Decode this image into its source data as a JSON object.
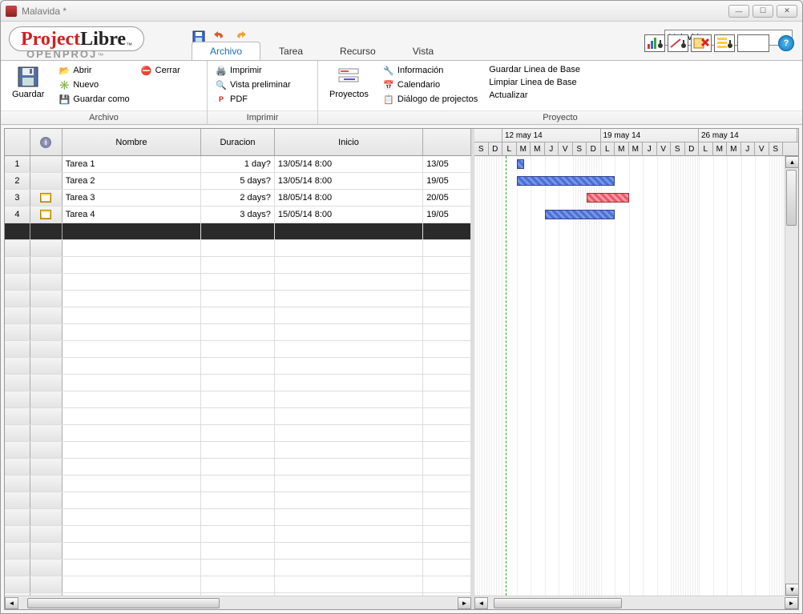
{
  "window_title": "Malavida *",
  "logo": {
    "part1": "Project",
    "part2": "Libre",
    "sub": "OPENPROJ"
  },
  "project_combo": "Malavida",
  "tabs": {
    "archivo": "Archivo",
    "tarea": "Tarea",
    "recurso": "Recurso",
    "vista": "Vista"
  },
  "ribbon": {
    "archivo": {
      "guardar": "Guardar",
      "abrir": "Abrir",
      "nuevo": "Nuevo",
      "guardar_como": "Guardar como",
      "cerrar": "Cerrar",
      "label": "Archivo"
    },
    "imprimir": {
      "imprimir": "Imprimir",
      "vista_prelim": "Vista preliminar",
      "pdf": "PDF",
      "label": "Imprimir"
    },
    "proyecto": {
      "proyectos": "Proyectos",
      "informacion": "Información",
      "calendario": "Calendario",
      "dialogo": "Diálogo de projectos",
      "guardar_linea": "Guardar Linea de Base",
      "limpiar_linea": "Limpiar Linea de Base",
      "actualizar": "Actualizar",
      "label": "Proyecto"
    }
  },
  "grid": {
    "headers": {
      "nombre": "Nombre",
      "duracion": "Duracion",
      "inicio": "Inicio"
    },
    "rows": [
      {
        "n": "1",
        "icon": "",
        "name": "Tarea 1",
        "dur": "1 day?",
        "start": "13/05/14 8:00",
        "end": "13/05"
      },
      {
        "n": "2",
        "icon": "",
        "name": "Tarea 2",
        "dur": "5 days?",
        "start": "13/05/14 8:00",
        "end": "19/05"
      },
      {
        "n": "3",
        "icon": "cal",
        "name": "Tarea 3",
        "dur": "2 days?",
        "start": "18/05/14 8:00",
        "end": "20/05"
      },
      {
        "n": "4",
        "icon": "cal",
        "name": "Tarea 4",
        "dur": "3 days?",
        "start": "15/05/14 8:00",
        "end": "19/05"
      }
    ]
  },
  "timeline": {
    "weeks": [
      "12 may 14",
      "19 may 14",
      "26 may 14"
    ],
    "days": [
      "S",
      "D",
      "L",
      "M",
      "M",
      "J",
      "V",
      "S",
      "D",
      "L",
      "M",
      "M",
      "J",
      "V",
      "S",
      "D",
      "L",
      "M",
      "M",
      "J",
      "V",
      "S"
    ]
  },
  "chart_data": {
    "type": "gantt",
    "tasks": [
      {
        "row": 1,
        "name": "Tarea 1",
        "start": "2014-05-13",
        "end": "2014-05-13",
        "color": "blue"
      },
      {
        "row": 2,
        "name": "Tarea 2",
        "start": "2014-05-13",
        "end": "2014-05-19",
        "color": "blue"
      },
      {
        "row": 3,
        "name": "Tarea 3",
        "start": "2014-05-18",
        "end": "2014-05-20",
        "color": "red"
      },
      {
        "row": 4,
        "name": "Tarea 4",
        "start": "2014-05-15",
        "end": "2014-05-19",
        "color": "blue"
      }
    ],
    "today": "2014-05-12",
    "view_start": "2014-05-10"
  }
}
